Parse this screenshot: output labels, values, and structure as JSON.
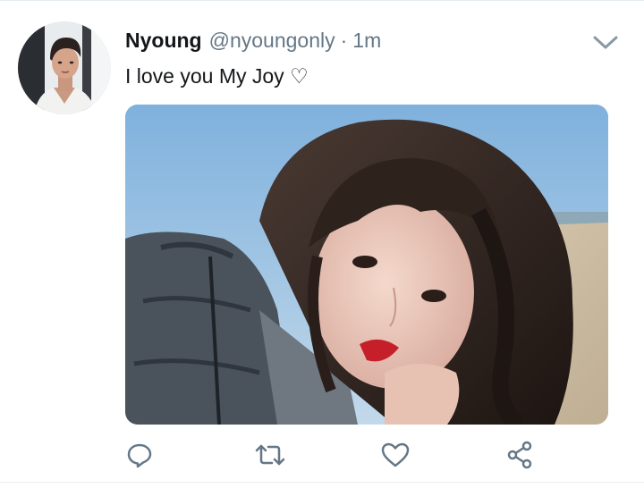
{
  "tweet": {
    "display_name": "Nyoung",
    "handle": "@nyoungonly",
    "separator": "·",
    "timestamp": "1m",
    "text": "I love you My Joy ♡"
  },
  "icons": {
    "menu": "chevron-down-icon",
    "reply": "reply-icon",
    "retweet": "retweet-icon",
    "like": "heart-icon",
    "share": "share-icon"
  },
  "colors": {
    "text": "#14171a",
    "secondary": "#657786",
    "icon": "#657786"
  }
}
